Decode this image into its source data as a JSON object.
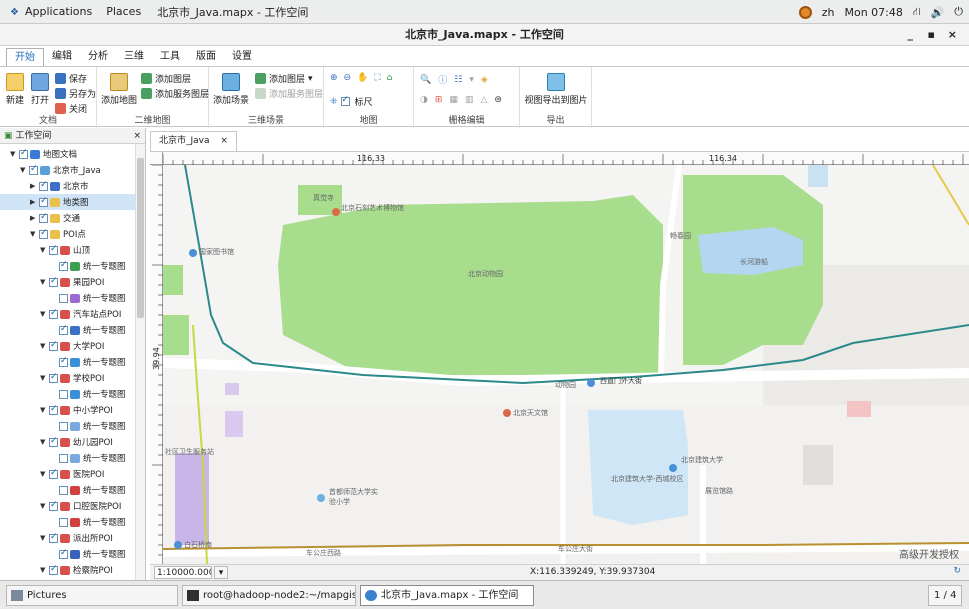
{
  "topbar": {
    "applications": "Applications",
    "places": "Places",
    "window_title": "北京市_Java.mapx - 工作空间",
    "lang": "zh",
    "clock": "Mon 07:48"
  },
  "titlebar": {
    "title": "北京市_Java.mapx - 工作空间",
    "min": "_",
    "max": "▪",
    "close": "×"
  },
  "menu": [
    "开始",
    "编辑",
    "分析",
    "三维",
    "工具",
    "版面",
    "设置"
  ],
  "ribbon": {
    "doc": {
      "new": "新建",
      "open": "打开",
      "save": "保存",
      "save_as": "另存为",
      "close": "关闭",
      "label": "文档"
    },
    "map2d": {
      "add_map": "添加地图",
      "add_layer": "添加图层",
      "add_service_layer": "添加服务图层",
      "label": "二维地图"
    },
    "scene3d": {
      "add_scene": "添加场景",
      "add_layer": "添加图层",
      "add_service_layer": "添加服务图层",
      "label": "三维场景"
    },
    "map": {
      "ruler": "标尺",
      "label": "地图"
    },
    "grid": {
      "label": "栅格编辑"
    },
    "export": {
      "export_image": "视图导出到图片",
      "label": "导出"
    }
  },
  "sidebar": {
    "title": "工作空间",
    "close": "×",
    "tree": [
      {
        "label": "地图文档",
        "depth": 0,
        "arrow": "▼",
        "checked": true,
        "icon": "#3a7bd5"
      },
      {
        "label": "北京市_Java",
        "depth": 1,
        "arrow": "▼",
        "checked": true,
        "icon": "#5aa0d8"
      },
      {
        "label": "北京市",
        "depth": 2,
        "arrow": "▶",
        "checked": true,
        "icon": "#3b6fc9"
      },
      {
        "label": "地类图",
        "depth": 2,
        "arrow": "▶",
        "checked": true,
        "icon": "#e8c04a",
        "selected": true
      },
      {
        "label": "交通",
        "depth": 2,
        "arrow": "▶",
        "checked": true,
        "icon": "#e8c04a"
      },
      {
        "label": "POI点",
        "depth": 2,
        "arrow": "▼",
        "checked": true,
        "icon": "#e8c04a"
      },
      {
        "label": "山顶",
        "depth": 3,
        "arrow": "▼",
        "checked": true,
        "icon": "#d7504a"
      },
      {
        "label": "统一专题图",
        "depth": 4,
        "arrow": "",
        "checked": true,
        "icon": "#3aa050"
      },
      {
        "label": "果园POI",
        "depth": 3,
        "arrow": "▼",
        "checked": true,
        "icon": "#d7504a"
      },
      {
        "label": "统一专题图",
        "depth": 4,
        "arrow": "",
        "checked": false,
        "icon": "#9a6ad0"
      },
      {
        "label": "汽车站点POI",
        "depth": 3,
        "arrow": "▼",
        "checked": true,
        "icon": "#d7504a"
      },
      {
        "label": "统一专题图",
        "depth": 4,
        "arrow": "",
        "checked": true,
        "icon": "#3a70c8"
      },
      {
        "label": "大学POI",
        "depth": 3,
        "arrow": "▼",
        "checked": true,
        "icon": "#d7504a"
      },
      {
        "label": "统一专题图",
        "depth": 4,
        "arrow": "",
        "checked": true,
        "icon": "#3a90d8"
      },
      {
        "label": "学校POI",
        "depth": 3,
        "arrow": "▼",
        "checked": true,
        "icon": "#d7504a"
      },
      {
        "label": "统一专题图",
        "depth": 4,
        "arrow": "",
        "checked": false,
        "icon": "#3a90d8"
      },
      {
        "label": "中小学POI",
        "depth": 3,
        "arrow": "▼",
        "checked": true,
        "icon": "#d7504a"
      },
      {
        "label": "统一专题图",
        "depth": 4,
        "arrow": "",
        "checked": false,
        "icon": "#7aa8e0"
      },
      {
        "label": "幼儿园POI",
        "depth": 3,
        "arrow": "▼",
        "checked": true,
        "icon": "#d7504a"
      },
      {
        "label": "统一专题图",
        "depth": 4,
        "arrow": "",
        "checked": false,
        "icon": "#7aa8e0"
      },
      {
        "label": "医院POI",
        "depth": 3,
        "arrow": "▼",
        "checked": true,
        "icon": "#d7504a"
      },
      {
        "label": "统一专题图",
        "depth": 4,
        "arrow": "",
        "checked": false,
        "icon": "#d04040"
      },
      {
        "label": "口腔医院POI",
        "depth": 3,
        "arrow": "▼",
        "checked": true,
        "icon": "#d7504a"
      },
      {
        "label": "统一专题图",
        "depth": 4,
        "arrow": "",
        "checked": false,
        "icon": "#d04040"
      },
      {
        "label": "派出所POI",
        "depth": 3,
        "arrow": "▼",
        "checked": true,
        "icon": "#d7504a"
      },
      {
        "label": "统一专题图",
        "depth": 4,
        "arrow": "",
        "checked": true,
        "icon": "#3a60c0"
      },
      {
        "label": "检察院POI",
        "depth": 3,
        "arrow": "▼",
        "checked": true,
        "icon": "#d7504a"
      }
    ]
  },
  "doc_tab": {
    "label": "北京市_Java",
    "close": "×"
  },
  "ruler": {
    "x1": "116.33",
    "x2": "116.34",
    "y1": "39.94"
  },
  "map_labels": {
    "museum": "北京石刻艺术博物馆",
    "courtyard": "真觉寺",
    "library": "国家图书馆",
    "zoo": "北京动物园",
    "changchun": "畅春园",
    "lake": "长河游船",
    "zoo_station": "动物园",
    "xizhimenwai": "西直门外大街",
    "planetarium": "北京天文馆",
    "clinic": "社区卫生服务站",
    "bucea": "北京建筑大学",
    "bucea_campus": "北京建筑大学-西城校区",
    "zhanlan": "展览馆路",
    "school": "首都师范大学实验小学",
    "baishiqiao": "白石桥南",
    "chegongzhuang_w": "车公庄西路",
    "chegongzhuang": "车公庄大街",
    "license": "高级开发授权"
  },
  "status": {
    "scale": "1:10000.0000",
    "coords": "X:116.339249, Y:39.937304"
  },
  "taskbar": {
    "t1": "Pictures",
    "t2": "root@hadoop-node2:~/mapgis10/pr...",
    "t3": "北京市_Java.mapx - 工作空间",
    "pager": "1 / 4"
  },
  "colors": {
    "accent": "#2a6ebb",
    "park": "#a8dd8e",
    "water": "#b4d6f0",
    "road_main": "#2a8a8a",
    "road_ring": "#c9b24a",
    "road_south": "#b89030"
  }
}
